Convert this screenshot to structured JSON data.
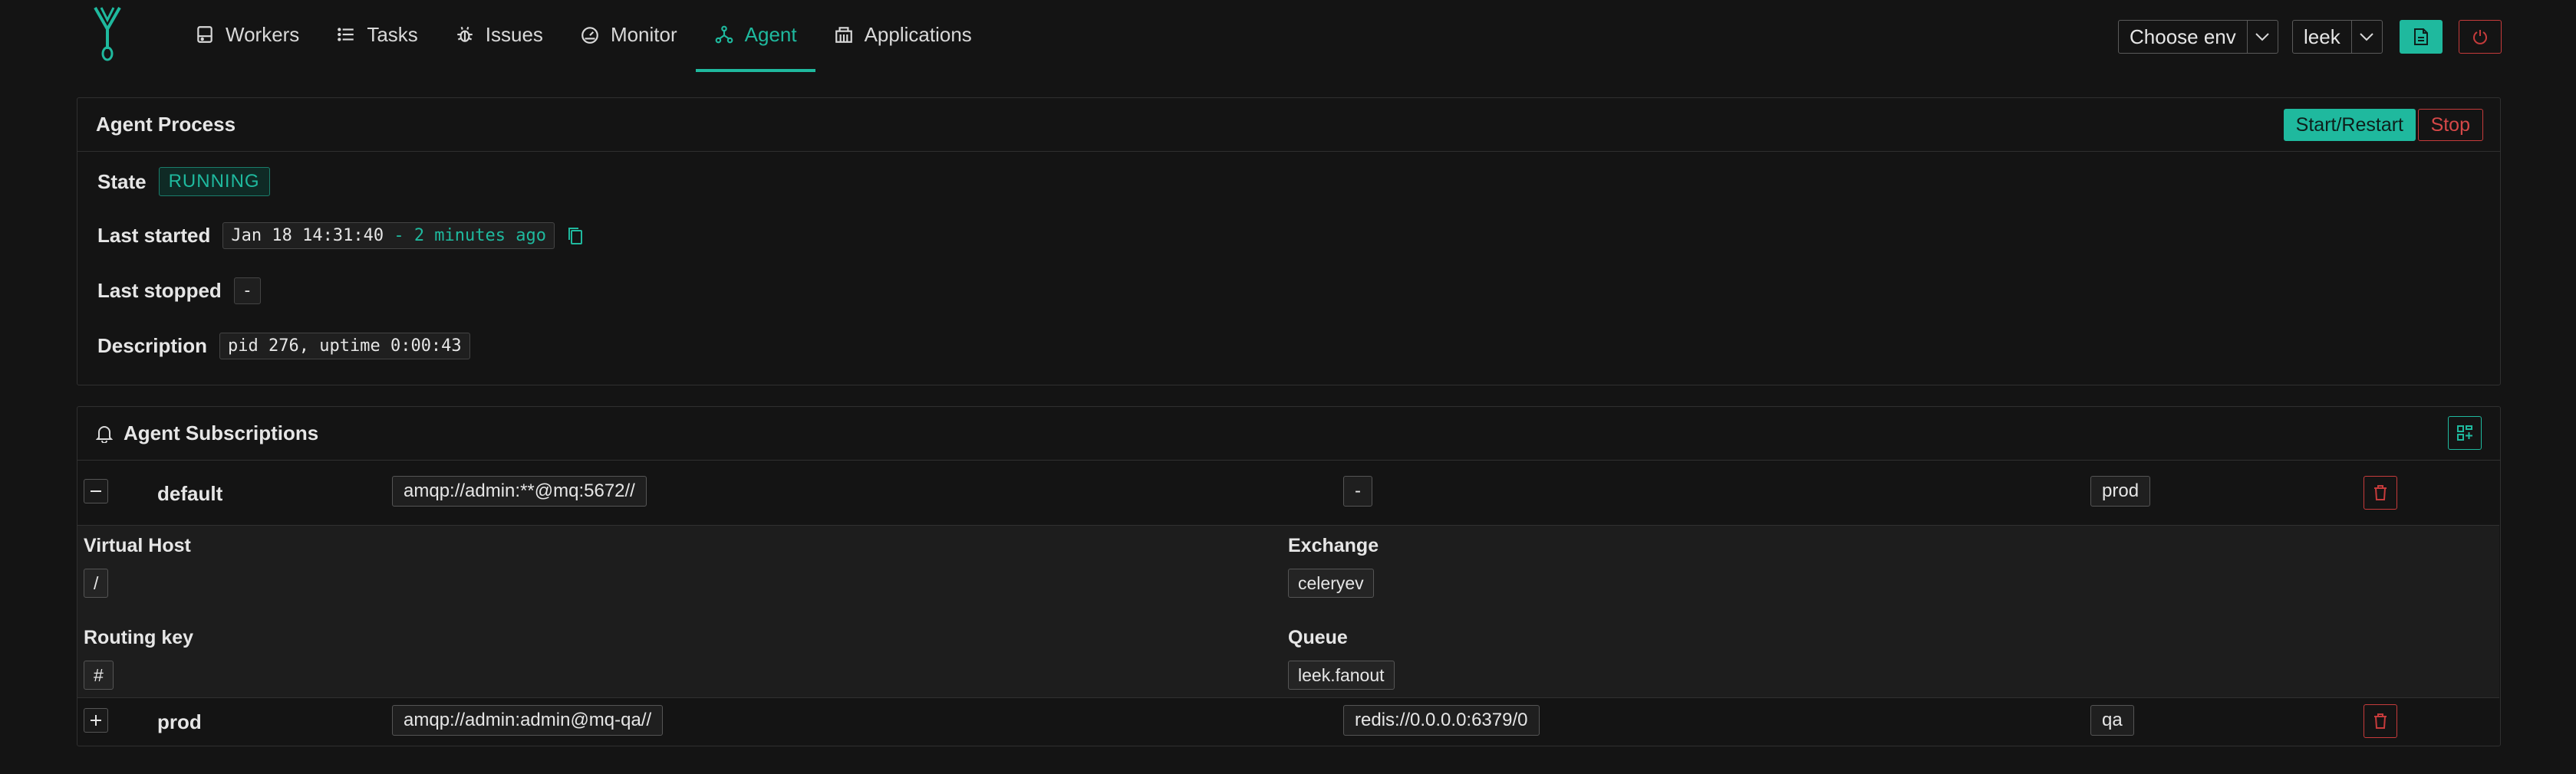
{
  "nav": {
    "items": [
      {
        "label": "Workers",
        "icon": "server-icon"
      },
      {
        "label": "Tasks",
        "icon": "list-icon"
      },
      {
        "label": "Issues",
        "icon": "bug-icon"
      },
      {
        "label": "Monitor",
        "icon": "dashboard-icon"
      },
      {
        "label": "Agent",
        "icon": "agent-icon",
        "active": true
      },
      {
        "label": "Applications",
        "icon": "applications-icon"
      }
    ]
  },
  "header": {
    "env_select": "Choose env",
    "app_select": "leek",
    "accent_color": "#1fb99e",
    "danger_color": "#c63b3b"
  },
  "agent_process": {
    "title": "Agent Process",
    "start_label": "Start/Restart",
    "stop_label": "Stop",
    "state_label": "State",
    "state_value": "RUNNING",
    "last_started_label": "Last started",
    "last_started_value": "Jan 18 14:31:40",
    "last_started_ago": " - 2 minutes ago",
    "last_stopped_label": "Last stopped",
    "last_stopped_value": "-",
    "description_label": "Description",
    "description_value": "pid 276, uptime 0:00:43"
  },
  "subscriptions": {
    "title": "Agent Subscriptions",
    "rows": [
      {
        "name": "default",
        "broker": "amqp://admin:**@mq:5672//",
        "backend": "-",
        "env": "prod",
        "expanded": true,
        "details": {
          "vhost_label": "Virtual Host",
          "vhost": "/",
          "exchange_label": "Exchange",
          "exchange": "celeryev",
          "routing_key_label": "Routing key",
          "routing_key": "#",
          "queue_label": "Queue",
          "queue": "leek.fanout"
        }
      },
      {
        "name": "prod",
        "broker": "amqp://admin:admin@mq-qa//",
        "backend": "redis://0.0.0.0:6379/0",
        "env": "qa",
        "expanded": false
      }
    ]
  }
}
